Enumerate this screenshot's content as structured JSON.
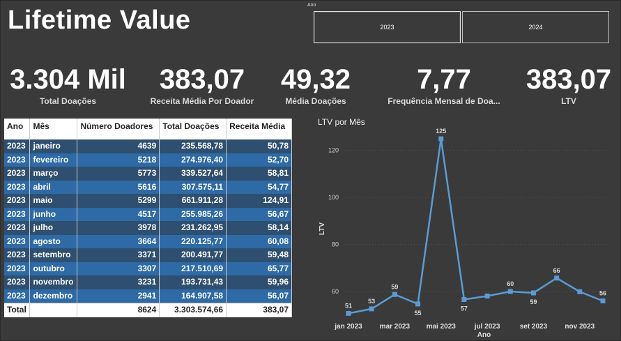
{
  "page": {
    "title": "Lifetime Value"
  },
  "slicer": {
    "label": "Ano",
    "options": [
      "2023",
      "2024"
    ],
    "selected": "2023"
  },
  "kpis": [
    {
      "value": "3.304 Mil",
      "label": "Total Doações"
    },
    {
      "value": "383,07",
      "label": "Receita Média Por Doador"
    },
    {
      "value": "49,32",
      "label": "Média Doações"
    },
    {
      "value": "7,77",
      "label": "Frequência Mensal de Doa..."
    },
    {
      "value": "383,07",
      "label": "LTV"
    }
  ],
  "table": {
    "headers": [
      "Ano",
      "Mês",
      "Número Doadores",
      "Total Doações",
      "Receita Média"
    ],
    "rows": [
      [
        "2023",
        "janeiro",
        "4639",
        "235.568,78",
        "50,78"
      ],
      [
        "2023",
        "fevereiro",
        "5218",
        "274.976,40",
        "52,70"
      ],
      [
        "2023",
        "março",
        "5773",
        "339.527,64",
        "58,81"
      ],
      [
        "2023",
        "abril",
        "5616",
        "307.575,11",
        "54,77"
      ],
      [
        "2023",
        "maio",
        "5299",
        "661.911,28",
        "124,91"
      ],
      [
        "2023",
        "junho",
        "4517",
        "255.985,26",
        "56,67"
      ],
      [
        "2023",
        "julho",
        "3978",
        "231.262,95",
        "58,14"
      ],
      [
        "2023",
        "agosto",
        "3664",
        "220.125,77",
        "60,08"
      ],
      [
        "2023",
        "setembro",
        "3371",
        "200.491,77",
        "59,48"
      ],
      [
        "2023",
        "outubro",
        "3307",
        "217.510,69",
        "65,77"
      ],
      [
        "2023",
        "novembro",
        "3231",
        "193.731,43",
        "59,96"
      ],
      [
        "2023",
        "dezembro",
        "2941",
        "164.907,58",
        "56,07"
      ]
    ],
    "total": [
      "Total",
      "",
      "8624",
      "3.303.574,66",
      "383,07"
    ]
  },
  "chart_data": {
    "type": "line",
    "title": "LTV por Mês",
    "xlabel": "Ano",
    "ylabel": "LTV",
    "x": [
      "jan 2023",
      "fev 2023",
      "mar 2023",
      "abr 2023",
      "mai 2023",
      "jun 2023",
      "jul 2023",
      "ago 2023",
      "set 2023",
      "out 2023",
      "nov 2023",
      "dez 2023"
    ],
    "xticks": [
      "jan 2023",
      "mar 2023",
      "mai 2023",
      "jul 2023",
      "set 2023",
      "nov 2023"
    ],
    "values": [
      50.78,
      52.7,
      58.81,
      54.77,
      124.91,
      56.67,
      58.14,
      60.08,
      59.48,
      65.77,
      59.96,
      56.07
    ],
    "data_labels": [
      "51",
      "53",
      "59",
      "55",
      "125",
      "57",
      "",
      "60",
      "59",
      "66",
      "",
      "56"
    ],
    "yticks": [
      60,
      80,
      100,
      120
    ],
    "ylim": [
      50,
      127
    ],
    "grid": true,
    "color": "#5b9bd5"
  }
}
